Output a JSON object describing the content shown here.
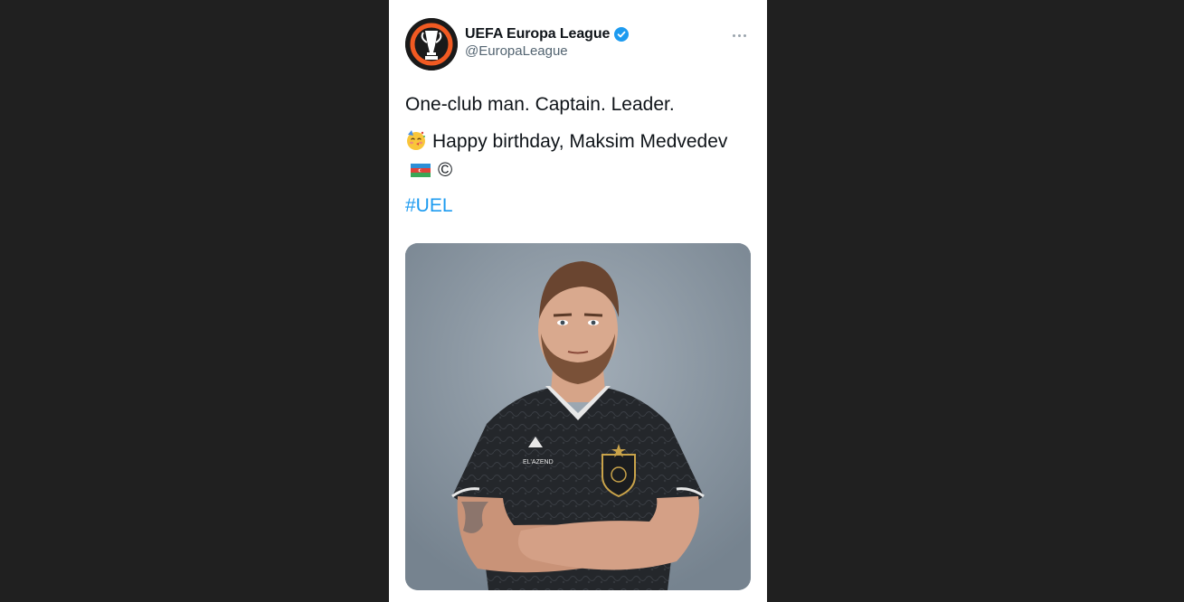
{
  "tweet": {
    "author": {
      "display_name": "UEFA Europa League",
      "handle": "@EuropaLeague",
      "verified": true,
      "avatar_icon": "europa-league-trophy-logo"
    },
    "more_icon": "more-options-icon",
    "text": {
      "line1": "One-club man. Captain. Leader.",
      "line2_emoji": "party-face-emoji",
      "line2_text": "Happy birthday, Maksim Medvedev",
      "line2_flag": "azerbaijan-flag-emoji",
      "line2_symbol": "©",
      "hashtag": "#UEL"
    },
    "media": {
      "description_icon": "player-photo",
      "jersey_brand": "EL'AZEND"
    }
  },
  "colors": {
    "background": "#202020",
    "card": "#ffffff",
    "text": "#0f1419",
    "secondary_text": "#536471",
    "link": "#1d9bf0",
    "verified": "#1d9bf0",
    "avatar_accent": "#f15a22"
  }
}
